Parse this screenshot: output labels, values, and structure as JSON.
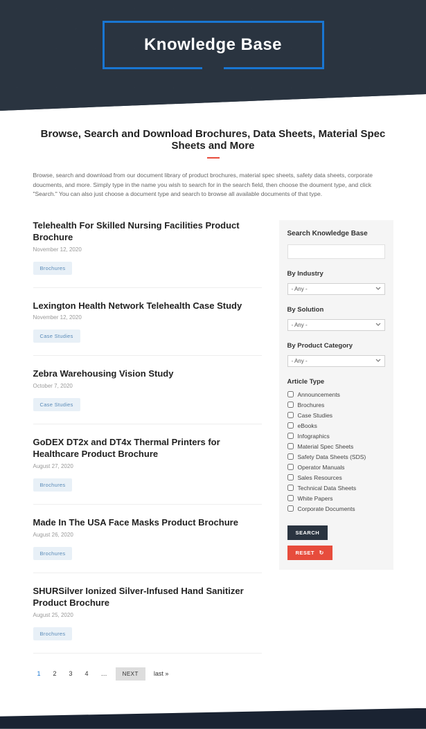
{
  "hero": {
    "title": "Knowledge Base"
  },
  "intro": {
    "heading": "Browse, Search and Download Brochures, Data Sheets, Material Spec Sheets and More",
    "text": "Browse, search and download from our document library of product brochures, material spec sheets, safety data sheets, corporate doucments, and more.  Simply type in the name you wish to search for in the search field, then choose the doument type, and click \"Search.\"  You can also just choose a document type and search to browse all available documents of that type."
  },
  "articles": [
    {
      "title": "Telehealth For Skilled Nursing Facilities Product Brochure",
      "date": "November 12, 2020",
      "tag": "Brochures"
    },
    {
      "title": "Lexington Health Network Telehealth Case Study",
      "date": "November 12, 2020",
      "tag": "Case Studies"
    },
    {
      "title": "Zebra Warehousing Vision Study",
      "date": "October 7, 2020",
      "tag": "Case Studies"
    },
    {
      "title": "GoDEX DT2x and DT4x Thermal Printers for Healthcare Product Brochure",
      "date": "August 27, 2020",
      "tag": "Brochures"
    },
    {
      "title": "Made In The USA Face Masks Product Brochure",
      "date": "August 26, 2020",
      "tag": "Brochures"
    },
    {
      "title": "SHURSilver Ionized Silver-Infused Hand Sanitizer Product Brochure",
      "date": "August 25, 2020",
      "tag": "Brochures"
    }
  ],
  "sidebar": {
    "search_heading": "Search Knowledge Base",
    "search_value": "",
    "industry_label": "By Industry",
    "industry_selected": "- Any -",
    "solution_label": "By Solution",
    "solution_selected": "- Any -",
    "category_label": "By Product Category",
    "category_selected": "- Any -",
    "type_label": "Article Type",
    "types": [
      "Announcements",
      "Brochures",
      "Case Studies",
      "eBooks",
      "Infographics",
      "Material Spec Sheets",
      "Safety Data Sheets (SDS)",
      "Operator Manuals",
      "Sales Resources",
      "Technical Data Sheets",
      "White Papers",
      "Corporate Documents"
    ],
    "search_btn": "SEARCH",
    "reset_btn": "RESET"
  },
  "pagination": {
    "pages": [
      "1",
      "2",
      "3",
      "4"
    ],
    "ellipsis": "…",
    "next": "NEXT",
    "last": "last »"
  }
}
